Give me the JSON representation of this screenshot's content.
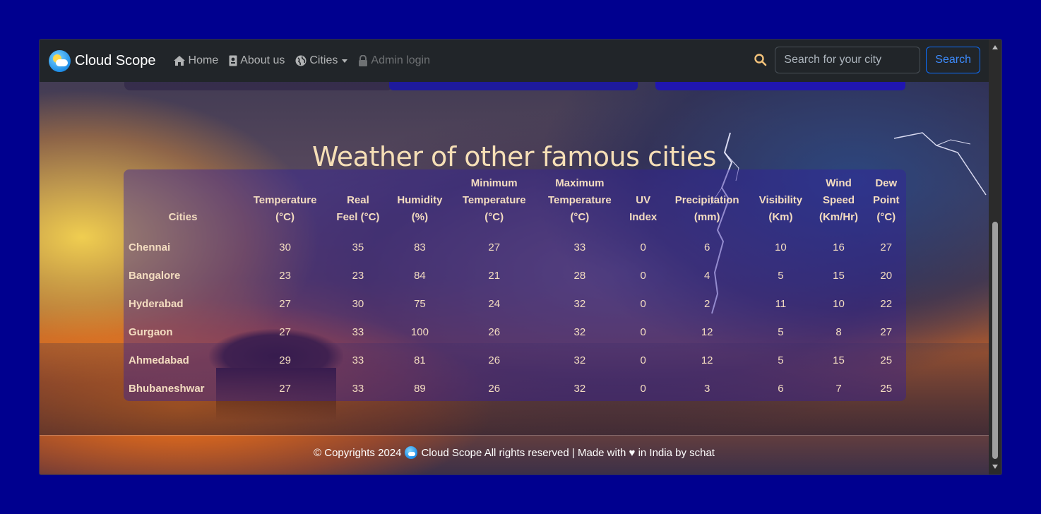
{
  "brand": {
    "name": "Cloud Scope"
  },
  "nav": {
    "home": "Home",
    "about": "About us",
    "cities": "Cities",
    "admin": "Admin login"
  },
  "search": {
    "placeholder": "Search for your city",
    "button": "Search"
  },
  "heading": "Weather of other famous cities",
  "table": {
    "headers": {
      "city": "Cities",
      "temp": [
        "Temperature",
        "(°C)"
      ],
      "feel": [
        "Real",
        "Feel (°C)"
      ],
      "humidity": [
        "Humidity",
        "(%)"
      ],
      "min": [
        "Minimum",
        "Temperature",
        "(°C)"
      ],
      "max": [
        "Maximum",
        "Temperature",
        "(°C)"
      ],
      "uv": [
        "UV",
        "Index"
      ],
      "precip": [
        "Precipitation",
        "(mm)"
      ],
      "vis": [
        "Visibility",
        "(Km)"
      ],
      "wind": [
        "Wind",
        "Speed",
        "(Km/Hr)"
      ],
      "dew": [
        "Dew",
        "Point",
        "(°C)"
      ]
    },
    "rows": [
      [
        "Chennai",
        "30",
        "35",
        "83",
        "27",
        "33",
        "0",
        "6",
        "10",
        "16",
        "27"
      ],
      [
        "Bangalore",
        "23",
        "23",
        "84",
        "21",
        "28",
        "0",
        "4",
        "5",
        "15",
        "20"
      ],
      [
        "Hyderabad",
        "27",
        "30",
        "75",
        "24",
        "32",
        "0",
        "2",
        "11",
        "10",
        "22"
      ],
      [
        "Gurgaon",
        "27",
        "33",
        "100",
        "26",
        "32",
        "0",
        "12",
        "5",
        "8",
        "27"
      ],
      [
        "Ahmedabad",
        "29",
        "33",
        "81",
        "26",
        "32",
        "0",
        "12",
        "5",
        "15",
        "25"
      ],
      [
        "Bhubaneshwar",
        "27",
        "33",
        "89",
        "26",
        "32",
        "0",
        "3",
        "6",
        "7",
        "25"
      ]
    ]
  },
  "footer": {
    "prefix": "© Copyrights 2024",
    "suffix": "Cloud Scope All rights reserved | Made with ♥ in India by schat"
  },
  "icons": {
    "home": "home-icon",
    "about": "contact-card-icon",
    "cities": "globe-icon",
    "admin": "lock-icon",
    "search": "search-icon"
  },
  "colors": {
    "page_bg": "#00008f",
    "navbar_bg": "#212529",
    "search_button": "#0d6efd",
    "heading_text": "#f6dfb6",
    "table_bg": "rgba(50,30,160,0.42)"
  }
}
